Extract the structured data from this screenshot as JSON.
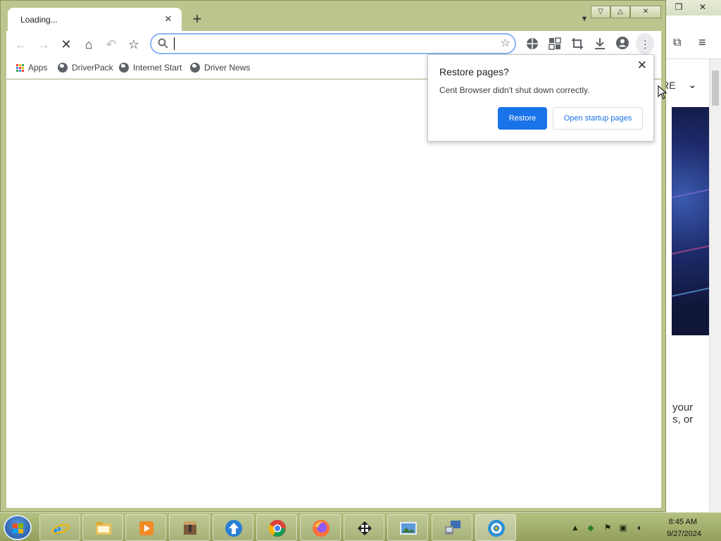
{
  "tab": {
    "title": "Loading...",
    "close_icon": "×",
    "new_tab_icon": "+"
  },
  "toolbar": {
    "back_icon": "←",
    "forward_icon": "→",
    "stop_icon": "✕",
    "home_icon": "⌂",
    "undo_icon": "↶",
    "bookmark_icon": "☆",
    "omnibox": {
      "value": "",
      "placeholder": ""
    }
  },
  "bookmarks": [
    {
      "label": "Apps"
    },
    {
      "label": "DriverPack"
    },
    {
      "label": "Internet Start"
    },
    {
      "label": "Driver News"
    }
  ],
  "popup": {
    "title": "Restore pages?",
    "message": "Cent Browser didn't shut down correctly.",
    "restore_label": "Restore",
    "startup_label": "Open startup pages"
  },
  "background_window": {
    "menu_fragment": "RE",
    "text_line_1": "your",
    "text_line_2": "s, or"
  },
  "taskbar": {
    "time": "8:45 AM",
    "date": "9/27/2024",
    "apps": [
      "internet-explorer-icon",
      "file-explorer-icon",
      "media-player-icon",
      "archive-icon",
      "upload-icon",
      "chrome-icon",
      "firefox-icon",
      "terminal-icon",
      "photo-viewer-icon",
      "network-icon",
      "cent-browser-icon"
    ]
  },
  "colors": {
    "accent": "#1a73e8",
    "taskbar": "#a5b36e",
    "frame": "#bac68d"
  }
}
